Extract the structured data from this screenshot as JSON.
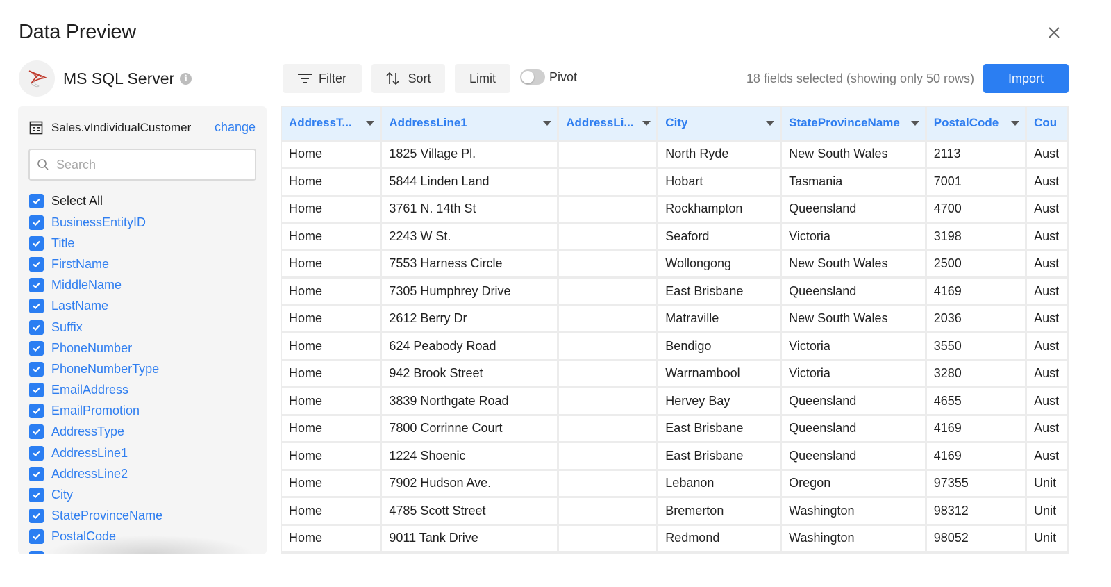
{
  "dialog": {
    "title": "Data Preview",
    "close_icon": "close-icon"
  },
  "source": {
    "name": "MS SQL Server",
    "logo_icon": "sql-server-logo-icon",
    "info_icon": "info-icon"
  },
  "panel": {
    "table_name": "Sales.vIndividualCustomer",
    "table_icon": "table-icon",
    "change_label": "change",
    "search_placeholder": "Search",
    "search_value": "",
    "select_all_label": "Select All",
    "fields": [
      {
        "label": "BusinessEntityID",
        "checked": true
      },
      {
        "label": "Title",
        "checked": true
      },
      {
        "label": "FirstName",
        "checked": true
      },
      {
        "label": "MiddleName",
        "checked": true
      },
      {
        "label": "LastName",
        "checked": true
      },
      {
        "label": "Suffix",
        "checked": true
      },
      {
        "label": "PhoneNumber",
        "checked": true
      },
      {
        "label": "PhoneNumberType",
        "checked": true
      },
      {
        "label": "EmailAddress",
        "checked": true
      },
      {
        "label": "EmailPromotion",
        "checked": true
      },
      {
        "label": "AddressType",
        "checked": true
      },
      {
        "label": "AddressLine1",
        "checked": true
      },
      {
        "label": "AddressLine2",
        "checked": true
      },
      {
        "label": "City",
        "checked": true
      },
      {
        "label": "StateProvinceName",
        "checked": true
      },
      {
        "label": "PostalCode",
        "checked": true
      },
      {
        "label": "",
        "checked": true
      }
    ]
  },
  "toolbar": {
    "filter_label": "Filter",
    "sort_label": "Sort",
    "limit_label": "Limit",
    "pivot_label": "Pivot",
    "pivot_on": false,
    "status": "18 fields selected (showing only 50 rows)",
    "import_label": "Import"
  },
  "colors": {
    "accent": "#2b7ef2",
    "header_bg": "#e4f1fd",
    "panel_bg": "#f5f5f5"
  },
  "grid": {
    "columns": [
      "AddressT...",
      "AddressLine1",
      "AddressLi...",
      "City",
      "StateProvinceName",
      "PostalCode",
      "Cou"
    ],
    "rows": [
      [
        "Home",
        "1825 Village Pl.",
        "",
        "North Ryde",
        "New South Wales",
        "2113",
        "Aust"
      ],
      [
        "Home",
        "5844 Linden Land",
        "",
        "Hobart",
        "Tasmania",
        "7001",
        "Aust"
      ],
      [
        "Home",
        "3761 N. 14th St",
        "",
        "Rockhampton",
        "Queensland",
        "4700",
        "Aust"
      ],
      [
        "Home",
        "2243 W St.",
        "",
        "Seaford",
        "Victoria",
        "3198",
        "Aust"
      ],
      [
        "Home",
        "7553 Harness Circle",
        "",
        "Wollongong",
        "New South Wales",
        "2500",
        "Aust"
      ],
      [
        "Home",
        "7305 Humphrey Drive",
        "",
        "East Brisbane",
        "Queensland",
        "4169",
        "Aust"
      ],
      [
        "Home",
        "2612 Berry Dr",
        "",
        "Matraville",
        "New South Wales",
        "2036",
        "Aust"
      ],
      [
        "Home",
        "624 Peabody Road",
        "",
        "Bendigo",
        "Victoria",
        "3550",
        "Aust"
      ],
      [
        "Home",
        "942 Brook Street",
        "",
        "Warrnambool",
        "Victoria",
        "3280",
        "Aust"
      ],
      [
        "Home",
        "3839 Northgate Road",
        "",
        "Hervey Bay",
        "Queensland",
        "4655",
        "Aust"
      ],
      [
        "Home",
        "7800 Corrinne Court",
        "",
        "East Brisbane",
        "Queensland",
        "4169",
        "Aust"
      ],
      [
        "Home",
        "1224 Shoenic",
        "",
        "East Brisbane",
        "Queensland",
        "4169",
        "Aust"
      ],
      [
        "Home",
        "7902 Hudson Ave.",
        "",
        "Lebanon",
        "Oregon",
        "97355",
        "Unit"
      ],
      [
        "Home",
        "4785 Scott Street",
        "",
        "Bremerton",
        "Washington",
        "98312",
        "Unit"
      ],
      [
        "Home",
        "9011 Tank Drive",
        "",
        "Redmond",
        "Washington",
        "98052",
        "Unit"
      ],
      [
        "",
        "",
        "",
        "",
        "",
        "",
        ""
      ]
    ]
  }
}
